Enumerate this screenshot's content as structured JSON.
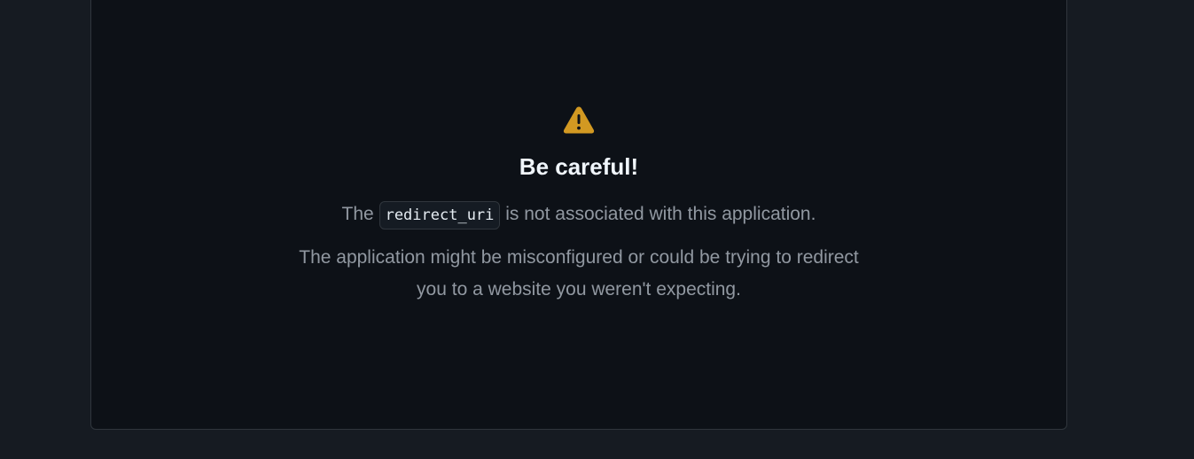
{
  "warning": {
    "icon": "alert-triangle-icon",
    "color": "#d29922",
    "title": "Be careful!"
  },
  "message": {
    "line1_prefix": "The",
    "code_term": "redirect_uri",
    "line1_suffix": "is not associated with this application.",
    "paragraph": "The application might be misconfigured or could be trying to redirect you to a website you weren't expecting."
  }
}
